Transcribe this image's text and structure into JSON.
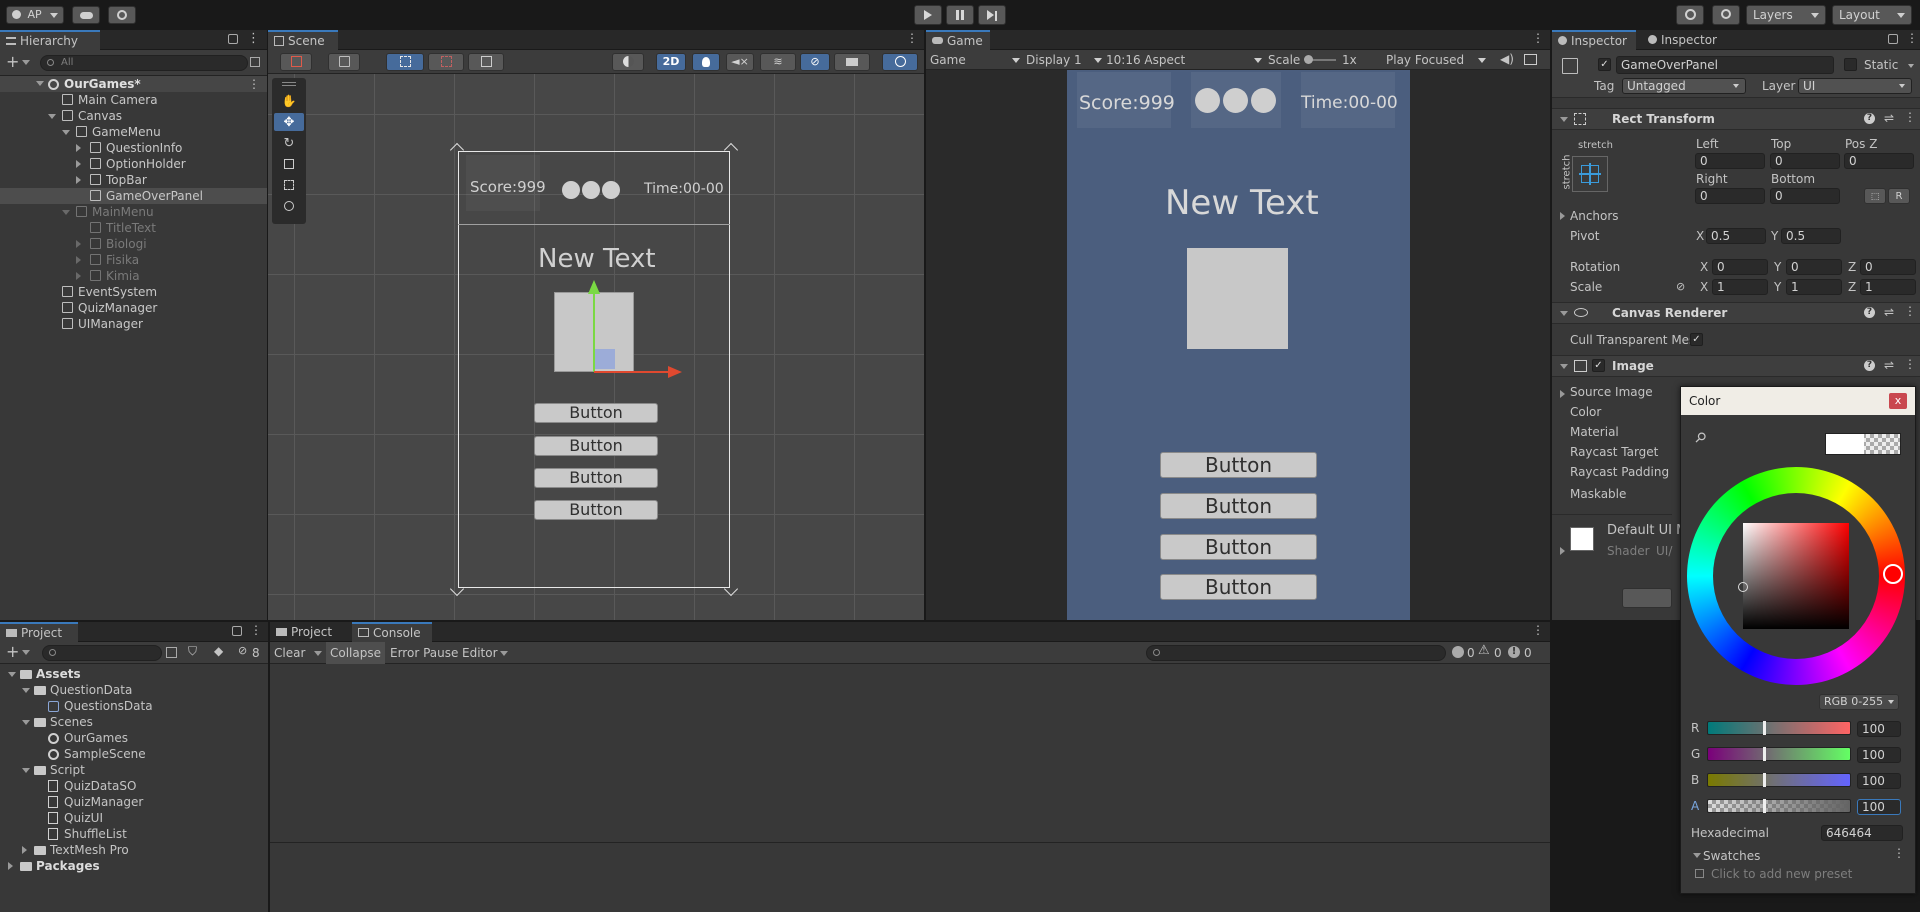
{
  "topbar": {
    "account": "AP",
    "layers": "Layers",
    "layout": "Layout"
  },
  "hierarchy": {
    "tab": "Hierarchy",
    "search_placeholder": "All",
    "scene": "OurGames*",
    "items": [
      {
        "label": "Main Camera",
        "depth": 1,
        "arrow": "none",
        "dim": false,
        "selected": false
      },
      {
        "label": "Canvas",
        "depth": 1,
        "arrow": "down",
        "dim": false,
        "selected": false
      },
      {
        "label": "GameMenu",
        "depth": 2,
        "arrow": "down",
        "dim": false,
        "selected": false
      },
      {
        "label": "QuestionInfo",
        "depth": 3,
        "arrow": "right",
        "dim": false,
        "selected": false
      },
      {
        "label": "OptionHolder",
        "depth": 3,
        "arrow": "right",
        "dim": false,
        "selected": false
      },
      {
        "label": "TopBar",
        "depth": 3,
        "arrow": "right",
        "dim": false,
        "selected": false
      },
      {
        "label": "GameOverPanel",
        "depth": 3,
        "arrow": "none",
        "dim": false,
        "selected": true
      },
      {
        "label": "MainMenu",
        "depth": 2,
        "arrow": "down",
        "dim": true,
        "selected": false
      },
      {
        "label": "TitleText",
        "depth": 3,
        "arrow": "none",
        "dim": true,
        "selected": false
      },
      {
        "label": "Biologi",
        "depth": 3,
        "arrow": "right",
        "dim": true,
        "selected": false
      },
      {
        "label": "Fisika",
        "depth": 3,
        "arrow": "right",
        "dim": true,
        "selected": false
      },
      {
        "label": "Kimia",
        "depth": 3,
        "arrow": "right",
        "dim": true,
        "selected": false
      },
      {
        "label": "EventSystem",
        "depth": 1,
        "arrow": "none",
        "dim": false,
        "selected": false
      },
      {
        "label": "QuizManager",
        "depth": 1,
        "arrow": "none",
        "dim": false,
        "selected": false
      },
      {
        "label": "UIManager",
        "depth": 1,
        "arrow": "none",
        "dim": false,
        "selected": false
      }
    ]
  },
  "scene": {
    "tab": "Scene",
    "mode_2d": "2D",
    "score": "Score:999",
    "time": "Time:00-00",
    "new_text": "New Text",
    "buttons": [
      "Button",
      "Button",
      "Button",
      "Button"
    ]
  },
  "game": {
    "tab": "Game",
    "dropdown_game": "Game",
    "display": "Display 1",
    "aspect": "10:16 Aspect",
    "scale_label": "Scale",
    "scale_value": "1x",
    "play_focused": "Play Focused",
    "score": "Score:999",
    "time": "Time:00-00",
    "new_text": "New Text",
    "buttons": [
      "Button",
      "Button",
      "Button",
      "Button"
    ]
  },
  "inspector": {
    "tab1": "Inspector",
    "tab2": "Inspector",
    "object_name": "GameOverPanel",
    "static": "Static",
    "tag_label": "Tag",
    "tag_value": "Untagged",
    "layer_label": "Layer",
    "layer_value": "UI",
    "rect_transform": "Rect Transform",
    "stretch": "stretch",
    "left_label": "Left",
    "left": "0",
    "top_label": "Top",
    "top": "0",
    "posz_label": "Pos Z",
    "posz": "0",
    "right_label": "Right",
    "right": "0",
    "bottom_label": "Bottom",
    "bottom": "0",
    "anchors": "Anchors",
    "pivot": "Pivot",
    "pivot_x": "0.5",
    "pivot_y": "0.5",
    "rotation": "Rotation",
    "rot_x": "0",
    "rot_y": "0",
    "rot_z": "0",
    "scale": "Scale",
    "scale_x": "1",
    "scale_y": "1",
    "scale_z": "1",
    "axis_x": "X",
    "axis_y": "Y",
    "axis_z": "Z",
    "canvas_renderer": "Canvas Renderer",
    "cull": "Cull Transparent Mesh",
    "image": "Image",
    "image_props": [
      "Source Image",
      "Color",
      "Material",
      "Raycast Target",
      "Raycast Padding",
      "Maskable"
    ],
    "default_ui": "Default UI M",
    "shader_label": "Shader",
    "shader_value": "UI/"
  },
  "color_picker": {
    "title": "Color",
    "close": "x",
    "mode": "RGB 0-255",
    "channels": [
      {
        "label": "R",
        "value": "100",
        "level": 0.39
      },
      {
        "label": "G",
        "value": "100",
        "level": 0.39
      },
      {
        "label": "B",
        "value": "100",
        "level": 0.39
      },
      {
        "label": "A",
        "value": "100",
        "level": 0.39
      }
    ],
    "hex_label": "Hexadecimal",
    "hex": "646464",
    "swatches": "Swatches",
    "add_preset": "Click to add new preset",
    "colors": {
      "selected": "#646464",
      "hue": "#ff0000"
    }
  },
  "project": {
    "tab": "Project",
    "count": "8",
    "tree": [
      {
        "label": "Assets",
        "depth": 0,
        "arrow": "down",
        "type": "folder",
        "bold": true
      },
      {
        "label": "QuestionData",
        "depth": 1,
        "arrow": "down",
        "type": "folder",
        "bold": false
      },
      {
        "label": "QuestionsData",
        "depth": 2,
        "arrow": "none",
        "type": "asset",
        "bold": false
      },
      {
        "label": "Scenes",
        "depth": 1,
        "arrow": "down",
        "type": "folder",
        "bold": false
      },
      {
        "label": "OurGames",
        "depth": 2,
        "arrow": "none",
        "type": "scene",
        "bold": false
      },
      {
        "label": "SampleScene",
        "depth": 2,
        "arrow": "none",
        "type": "scene",
        "bold": false
      },
      {
        "label": "Script",
        "depth": 1,
        "arrow": "down",
        "type": "folder",
        "bold": false
      },
      {
        "label": "QuizDataSO",
        "depth": 2,
        "arrow": "none",
        "type": "script",
        "bold": false
      },
      {
        "label": "QuizManager",
        "depth": 2,
        "arrow": "none",
        "type": "script",
        "bold": false
      },
      {
        "label": "QuizUI",
        "depth": 2,
        "arrow": "none",
        "type": "script",
        "bold": false
      },
      {
        "label": "ShuffleList",
        "depth": 2,
        "arrow": "none",
        "type": "script",
        "bold": false
      },
      {
        "label": "TextMesh Pro",
        "depth": 1,
        "arrow": "right",
        "type": "folder",
        "bold": false
      },
      {
        "label": "Packages",
        "depth": 0,
        "arrow": "right",
        "type": "folder",
        "bold": true
      }
    ]
  },
  "console": {
    "tab_project": "Project",
    "tab_console": "Console",
    "clear": "Clear",
    "collapse": "Collapse",
    "error_pause": "Error Pause",
    "editor": "Editor",
    "count_log": "0",
    "count_warn": "0",
    "count_err": "0"
  }
}
